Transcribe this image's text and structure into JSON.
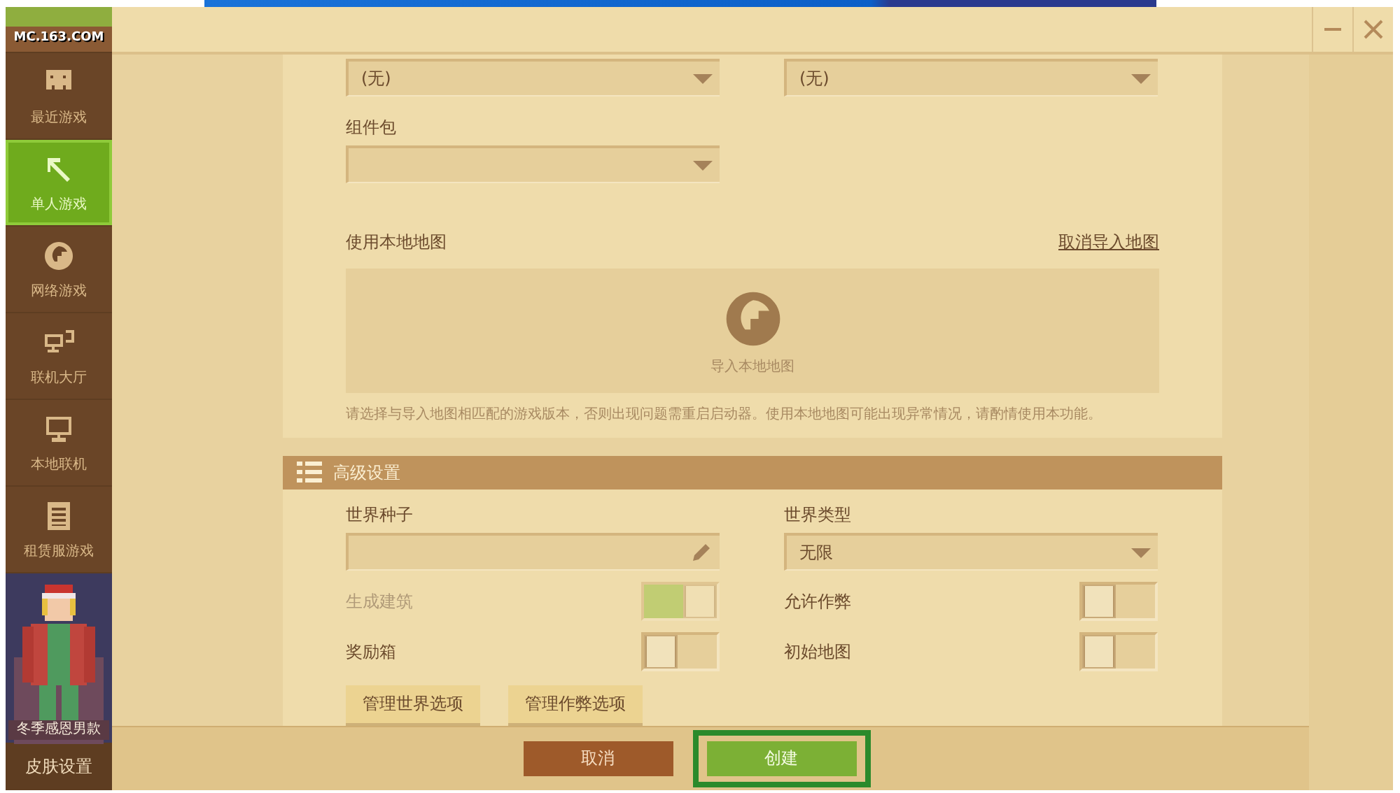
{
  "logo": {
    "text": "MC.163.COM"
  },
  "sidebar": {
    "items": [
      {
        "label": "最近游戏",
        "selected": false
      },
      {
        "label": "单人游戏",
        "selected": true
      },
      {
        "label": "网络游戏",
        "selected": false
      },
      {
        "label": "联机大厅",
        "selected": false
      },
      {
        "label": "本地联机",
        "selected": false
      },
      {
        "label": "租赁服游戏",
        "selected": false
      }
    ],
    "skin": {
      "caption": "冬季感恩男款",
      "kind": "picture",
      "button": "皮肤设置"
    }
  },
  "top_selects": [
    {
      "value": "(无)"
    },
    {
      "value": "(无)"
    }
  ],
  "component_pack": {
    "label": "组件包"
  },
  "local_map": {
    "label": "使用本地地图",
    "cancel_link": "取消导入地图",
    "import_label": "导入本地地图",
    "note": "请选择与导入地图相匹配的游戏版本，否则出现问题需重启启动器。使用本地地图可能出现异常情况，请酌情使用本功能。"
  },
  "advanced": {
    "title": "高级设置",
    "seed": {
      "label": "世界种子"
    },
    "world_type": {
      "label": "世界类型",
      "value": "无限"
    },
    "toggles": [
      {
        "label": "生成建筑",
        "on": true,
        "disabled": true
      },
      {
        "label": "允许作弊",
        "on": false,
        "disabled": false
      },
      {
        "label": "奖励箱",
        "on": false,
        "disabled": false
      },
      {
        "label": "初始地图",
        "on": false,
        "disabled": false
      }
    ],
    "buttons": [
      "管理世界选项",
      "管理作弊选项"
    ]
  },
  "footer": {
    "buttons": [
      {
        "label": "取消",
        "kind": "cancel"
      },
      {
        "label": "创建",
        "kind": "create",
        "highlighted": true
      }
    ]
  }
}
